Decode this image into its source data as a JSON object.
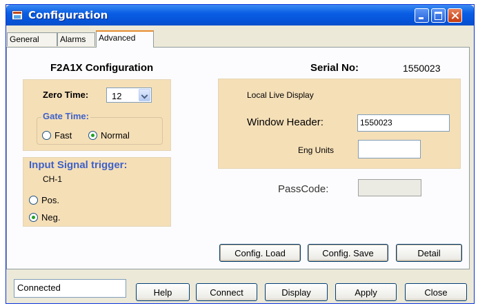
{
  "window": {
    "title": "Configuration"
  },
  "tabs": [
    "General",
    "Alarms",
    "Advanced"
  ],
  "advanced": {
    "heading": "F2A1X Configuration",
    "serial_label": "Serial No:",
    "serial_value": "1550023",
    "zero_time_label": "Zero Time:",
    "zero_time_value": "12",
    "gate_time_label": "Gate Time:",
    "gate_options": [
      "Fast",
      "Normal"
    ],
    "gate_selected": "Normal",
    "input_trigger_label": "Input Signal trigger:",
    "channel_label": "CH-1",
    "trigger_options": [
      "Pos.",
      "Neg."
    ],
    "trigger_selected": "Neg.",
    "local_display_label": "Local Live Display",
    "window_header_label": "Window Header:",
    "window_header_value": "1550023",
    "eng_units_label": "Eng Units",
    "eng_units_value": "",
    "passcode_label": "PassCode:",
    "passcode_value": "",
    "buttons": {
      "config_load": "Config. Load",
      "config_save": "Config. Save",
      "detail": "Detail"
    }
  },
  "footer": {
    "status": "Connected",
    "buttons": {
      "help": "Help",
      "connect": "Connect",
      "display": "Display",
      "apply": "Apply",
      "close": "Close"
    }
  },
  "colors": {
    "panel": "#f5dfb7",
    "title_bar": "#0553d8",
    "group_label": "#3e61c8",
    "radio_selected": "#21a121"
  }
}
